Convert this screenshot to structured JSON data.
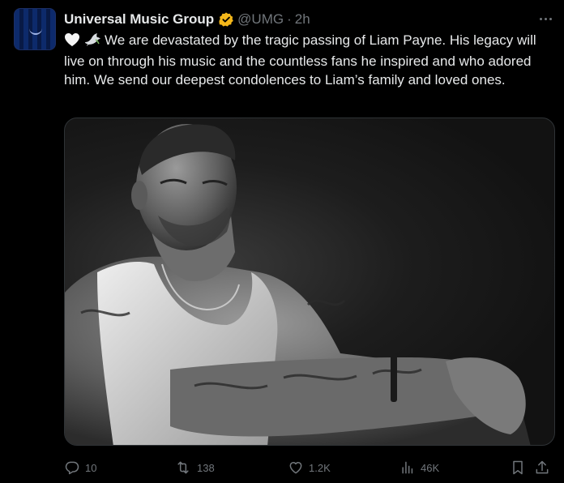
{
  "tweet": {
    "author": {
      "name": "Universal Music Group",
      "handle": "@UMG",
      "separator": "·",
      "time": "2h",
      "verified_color": "#f4b71a"
    },
    "text": "We are devastated by the tragic passing of Liam Payne. His legacy will live on through his music and the countless fans he inspired and who adored him. We send our deepest condolences to Liam’s family and loved ones.",
    "emojis": [
      "white-heart-icon",
      "dove-icon"
    ],
    "media": {
      "type": "black-and-white photograph",
      "subject": "tattooed man in white tank top seated on dark background"
    },
    "metrics": {
      "replies": "10",
      "reposts": "138",
      "likes": "1.2K",
      "views": "46K"
    }
  },
  "colors": {
    "background": "#000000",
    "text": "#e7e9ea",
    "muted": "#71767b",
    "border": "#2f3336"
  }
}
